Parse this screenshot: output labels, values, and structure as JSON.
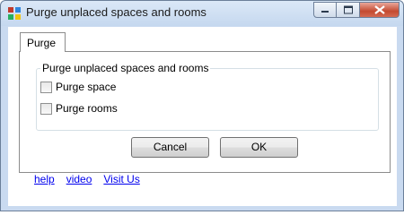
{
  "window": {
    "title": "Purge unplaced spaces and rooms",
    "controls": [
      "minimize",
      "maximize",
      "close"
    ]
  },
  "tabs": [
    {
      "label": "Purge",
      "selected": true
    }
  ],
  "group": {
    "legend": "Purge unplaced spaces and rooms",
    "options": [
      {
        "label": "Purge space",
        "checked": false
      },
      {
        "label": "Purge rooms",
        "checked": false
      }
    ]
  },
  "buttons": {
    "cancel": "Cancel",
    "ok": "OK"
  },
  "links": {
    "help": "help",
    "video": "video",
    "visit": "Visit Us"
  },
  "icons": {
    "app": "app-window-icon",
    "minimize": "minimize-icon",
    "maximize": "maximize-icon",
    "close": "close-icon"
  }
}
